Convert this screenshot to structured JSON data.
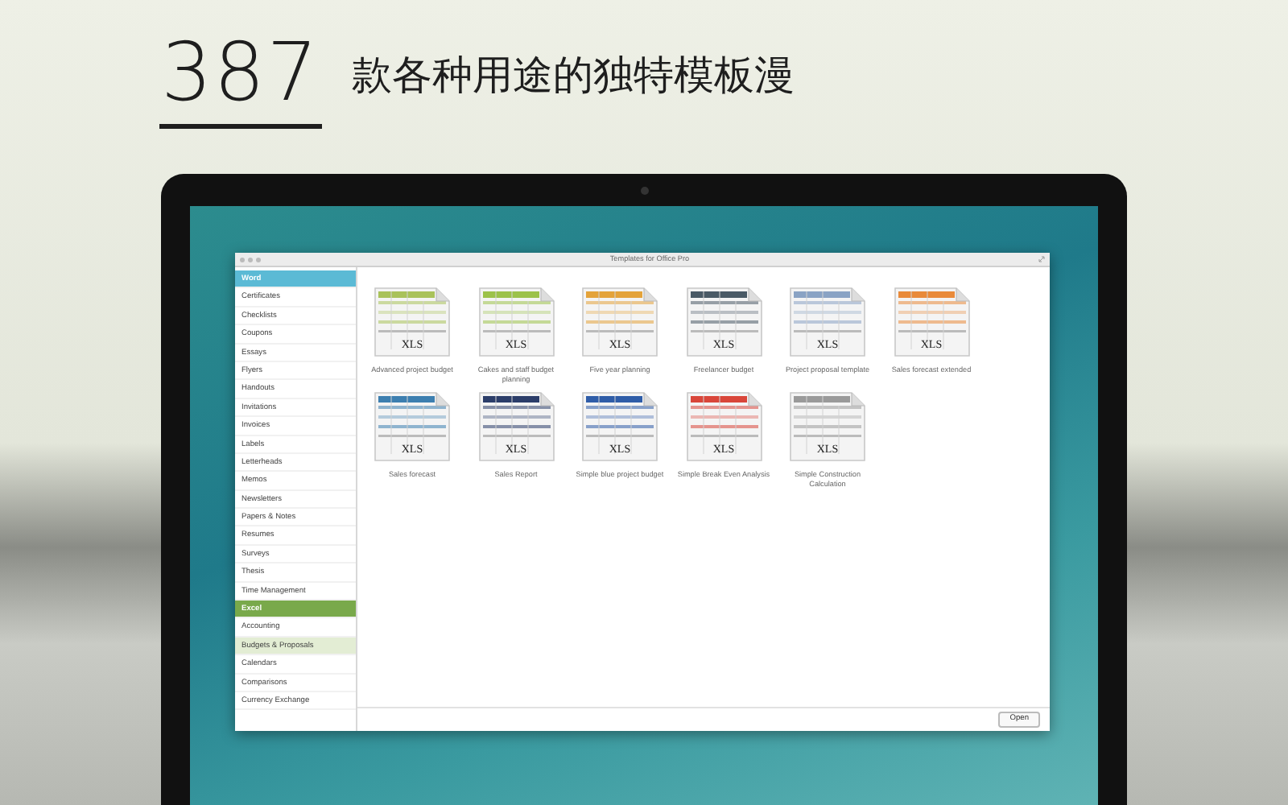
{
  "headline": {
    "number": "387",
    "text": "款各种用途的独特模板漫"
  },
  "window": {
    "title": "Templates for Office Pro"
  },
  "sidebar": {
    "groups": [
      {
        "label": "Word",
        "color": "#5bbad5",
        "items": [
          {
            "label": "Certificates",
            "selected": false
          },
          {
            "label": "Checklists",
            "selected": false
          },
          {
            "label": "Coupons",
            "selected": false
          },
          {
            "label": "Essays",
            "selected": false
          },
          {
            "label": "Flyers",
            "selected": false
          },
          {
            "label": "Handouts",
            "selected": false
          },
          {
            "label": "Invitations",
            "selected": false
          },
          {
            "label": "Invoices",
            "selected": false
          },
          {
            "label": "Labels",
            "selected": false
          },
          {
            "label": "Letterheads",
            "selected": false
          },
          {
            "label": "Memos",
            "selected": false
          },
          {
            "label": "Newsletters",
            "selected": false
          },
          {
            "label": "Papers & Notes",
            "selected": false
          },
          {
            "label": "Resumes",
            "selected": false
          },
          {
            "label": "Surveys",
            "selected": false
          },
          {
            "label": "Thesis",
            "selected": false
          },
          {
            "label": "Time Management",
            "selected": false
          }
        ]
      },
      {
        "label": "Excel",
        "color": "#79a94b",
        "items": [
          {
            "label": "Accounting",
            "selected": false
          },
          {
            "label": "Budgets & Proposals",
            "selected": true
          },
          {
            "label": "Calendars",
            "selected": false
          },
          {
            "label": "Comparisons",
            "selected": false
          },
          {
            "label": "Currency Exchange",
            "selected": false
          }
        ]
      }
    ]
  },
  "templates": [
    {
      "name": "Advanced project budget",
      "badge": "XLS",
      "color": "#a9c25a"
    },
    {
      "name": "Cakes and staff budget planning",
      "badge": "XLS",
      "color": "#9cc24a"
    },
    {
      "name": "Five year planning",
      "badge": "XLS",
      "color": "#e4a33a"
    },
    {
      "name": "Freelancer budget",
      "badge": "XLS",
      "color": "#4a5a66"
    },
    {
      "name": "Project proposal template",
      "badge": "XLS",
      "color": "#8aa3c4"
    },
    {
      "name": "Sales forecast extended",
      "badge": "XLS",
      "color": "#e98a3a"
    },
    {
      "name": "Sales forecast",
      "badge": "XLS",
      "color": "#3d7fb0"
    },
    {
      "name": "Sales Report",
      "badge": "XLS",
      "color": "#2c3e6a"
    },
    {
      "name": "Simple blue project budget",
      "badge": "XLS",
      "color": "#2f5da8"
    },
    {
      "name": "Simple Break Even Analysis",
      "badge": "XLS",
      "color": "#d9463a"
    },
    {
      "name": "Simple Construction Calculation",
      "badge": "XLS",
      "color": "#9a9a9a"
    }
  ],
  "buttons": [
    {
      "label": "Open"
    }
  ]
}
